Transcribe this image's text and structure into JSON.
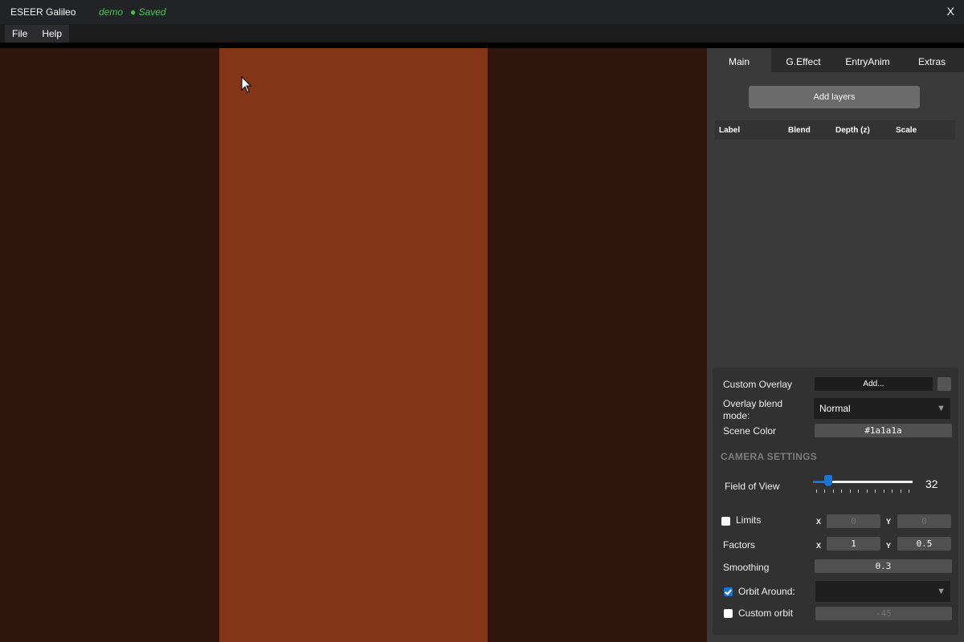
{
  "app": {
    "title": "ESEER Galileo",
    "project": "demo",
    "status": "● Saved",
    "close": "X"
  },
  "menu": {
    "items": [
      "File",
      "Help"
    ]
  },
  "canvas": {
    "background_color": "#2f150c",
    "strip_color": "#843518"
  },
  "panel": {
    "tabs": [
      "Main",
      "G.Effect",
      "EntryAnim",
      "Extras"
    ],
    "active_tab": "Main",
    "add_layers_label": "Add layers",
    "layer_columns": [
      "Label",
      "Blend",
      "Depth (z)",
      "Scale"
    ]
  },
  "settings": {
    "custom_overlay": {
      "label": "Custom Overlay",
      "button": "Add..."
    },
    "overlay_blend": {
      "label": "Overlay blend mode:",
      "value": "Normal"
    },
    "scene_color": {
      "label": "Scene Color",
      "value": "#1a1a1a"
    },
    "camera_title": "CAMERA SETTINGS",
    "fov": {
      "label": "Field of View",
      "value": "32",
      "fraction": 0.155
    },
    "limits": {
      "label": "Limits",
      "checked": false,
      "x_label": "X",
      "x": "0",
      "y_label": "Y",
      "y": "0"
    },
    "factors": {
      "label": "Factors",
      "x_label": "X",
      "x": "1",
      "y_label": "Y",
      "y": "0.5"
    },
    "smoothing": {
      "label": "Smoothing",
      "value": "0.3"
    },
    "orbit_around": {
      "label": "Orbit Around:",
      "checked": true,
      "value": ""
    },
    "custom_orbit": {
      "label": "Custom orbit",
      "checked": false,
      "value": "-45"
    }
  },
  "colors": {
    "accent": "#1a75d2",
    "saved": "#3cc84a"
  }
}
